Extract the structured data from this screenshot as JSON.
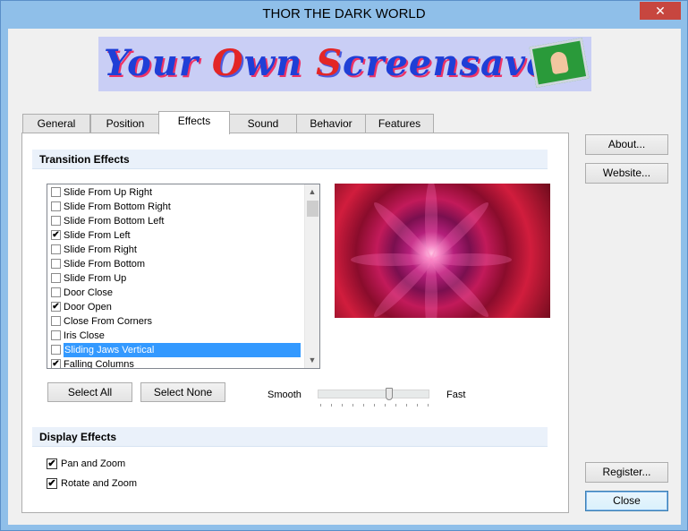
{
  "window": {
    "title": "THOR THE DARK WORLD",
    "close_glyph": "✕"
  },
  "banner": {
    "text_a": "Your ",
    "text_b": "O",
    "text_c": "wn ",
    "text_d": "S",
    "text_e": "creensaver"
  },
  "tabs": [
    {
      "label": "General"
    },
    {
      "label": "Position"
    },
    {
      "label": "Effects"
    },
    {
      "label": "Sound"
    },
    {
      "label": "Behavior"
    },
    {
      "label": "Features"
    }
  ],
  "active_tab": "Effects",
  "transition": {
    "heading": "Transition Effects",
    "items": [
      {
        "label": "Slide From Up Right",
        "checked": false
      },
      {
        "label": "Slide From Bottom Right",
        "checked": false
      },
      {
        "label": "Slide From Bottom Left",
        "checked": false
      },
      {
        "label": "Slide From Left",
        "checked": true
      },
      {
        "label": "Slide From Right",
        "checked": false
      },
      {
        "label": "Slide From Bottom",
        "checked": false
      },
      {
        "label": "Slide From Up",
        "checked": false
      },
      {
        "label": "Door Close",
        "checked": false
      },
      {
        "label": "Door Open",
        "checked": true
      },
      {
        "label": "Close From Corners",
        "checked": false
      },
      {
        "label": "Iris Close",
        "checked": false
      },
      {
        "label": "Sliding Jaws Vertical",
        "checked": false,
        "selected": true
      },
      {
        "label": "Falling Columns",
        "checked": true
      }
    ],
    "select_all": "Select All",
    "select_none": "Select None",
    "speed_smooth": "Smooth",
    "speed_fast": "Fast",
    "speed_value": 0.65
  },
  "display": {
    "heading": "Display Effects",
    "pan_zoom": {
      "label": "Pan and Zoom",
      "checked": true
    },
    "rotate_zoom": {
      "label": "Rotate and Zoom",
      "checked": true
    }
  },
  "side_buttons": {
    "about": "About...",
    "website": "Website...",
    "register": "Register...",
    "close": "Close"
  },
  "check_glyph": "✔",
  "arrow_up": "▲",
  "arrow_down": "▼"
}
